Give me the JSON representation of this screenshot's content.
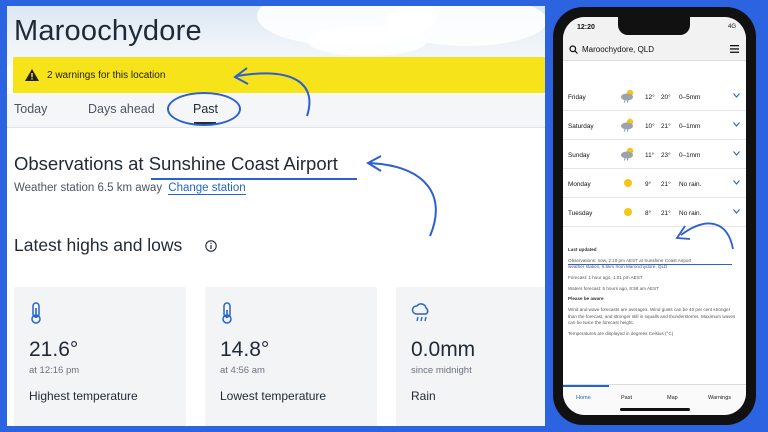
{
  "desktop": {
    "location_title": "Maroochydore",
    "warning_banner": "2 warnings for this location",
    "tabs": [
      "Today",
      "Days ahead",
      "Past"
    ],
    "observations_title": "Observations at Sunshine Coast Airport",
    "station_distance": "Weather station 6.5 km away",
    "change_station_link": "Change station",
    "highs_lows_title": "Latest highs and lows",
    "cards": [
      {
        "value": "21.6°",
        "sub": "at 12:16 pm",
        "label": "Highest temperature",
        "icon": "thermometer-icon"
      },
      {
        "value": "14.8°",
        "sub": "at 4:56 am",
        "label": "Lowest temperature",
        "icon": "thermometer-icon"
      },
      {
        "value": "0.0mm",
        "sub": "since midnight",
        "label": "Rain",
        "icon": "rain-cloud-icon"
      }
    ]
  },
  "phone": {
    "status_time": "12:20",
    "status_right": "4G",
    "search_location": "Maroochydore, QLD",
    "forecast": [
      {
        "day": "Friday",
        "min": "12°",
        "max": "20°",
        "rain": "0–5mm",
        "icon": "partly-cloudy-rain-icon"
      },
      {
        "day": "Saturday",
        "min": "10°",
        "max": "21°",
        "rain": "0–1mm",
        "icon": "partly-cloudy-rain-icon"
      },
      {
        "day": "Sunday",
        "min": "11°",
        "max": "23°",
        "rain": "0–1mm",
        "icon": "partly-cloudy-rain-icon"
      },
      {
        "day": "Monday",
        "min": "9°",
        "max": "21°",
        "rain": "No rain.",
        "icon": "sun-icon"
      },
      {
        "day": "Tuesday",
        "min": "8°",
        "max": "21°",
        "rain": "No rain.",
        "icon": "sun-icon"
      }
    ],
    "last_updated_label": "Last updated",
    "observations_text": "Observations: now, 2:10 pm AEST at Sunshine Coast Airport",
    "observations_text2": "weather station, 6.5km from Maroochydore, QLD",
    "forecast_text": "Forecast: 1 hour ago, 1:01 pm AEST",
    "waters_text": "Waters forecast: 5 hours ago, 8:58 am AEST",
    "please_aware": "Please be aware",
    "aware_text": "Wind and wave forecasts are averages. Wind gusts can be 40 per cent stronger than the forecast, and stronger still in squalls and thunderstorms. Maximum waves can be twice the forecast height.",
    "celsius_text": "Temperatures are displayed in degrees Celsius (°C)",
    "nav": [
      "Home",
      "Past",
      "Map",
      "Warnings"
    ]
  },
  "colors": {
    "background": "#2b63e0",
    "warning": "#f7e31a",
    "annotation": "#2c5fcf",
    "link": "#2565c6"
  }
}
